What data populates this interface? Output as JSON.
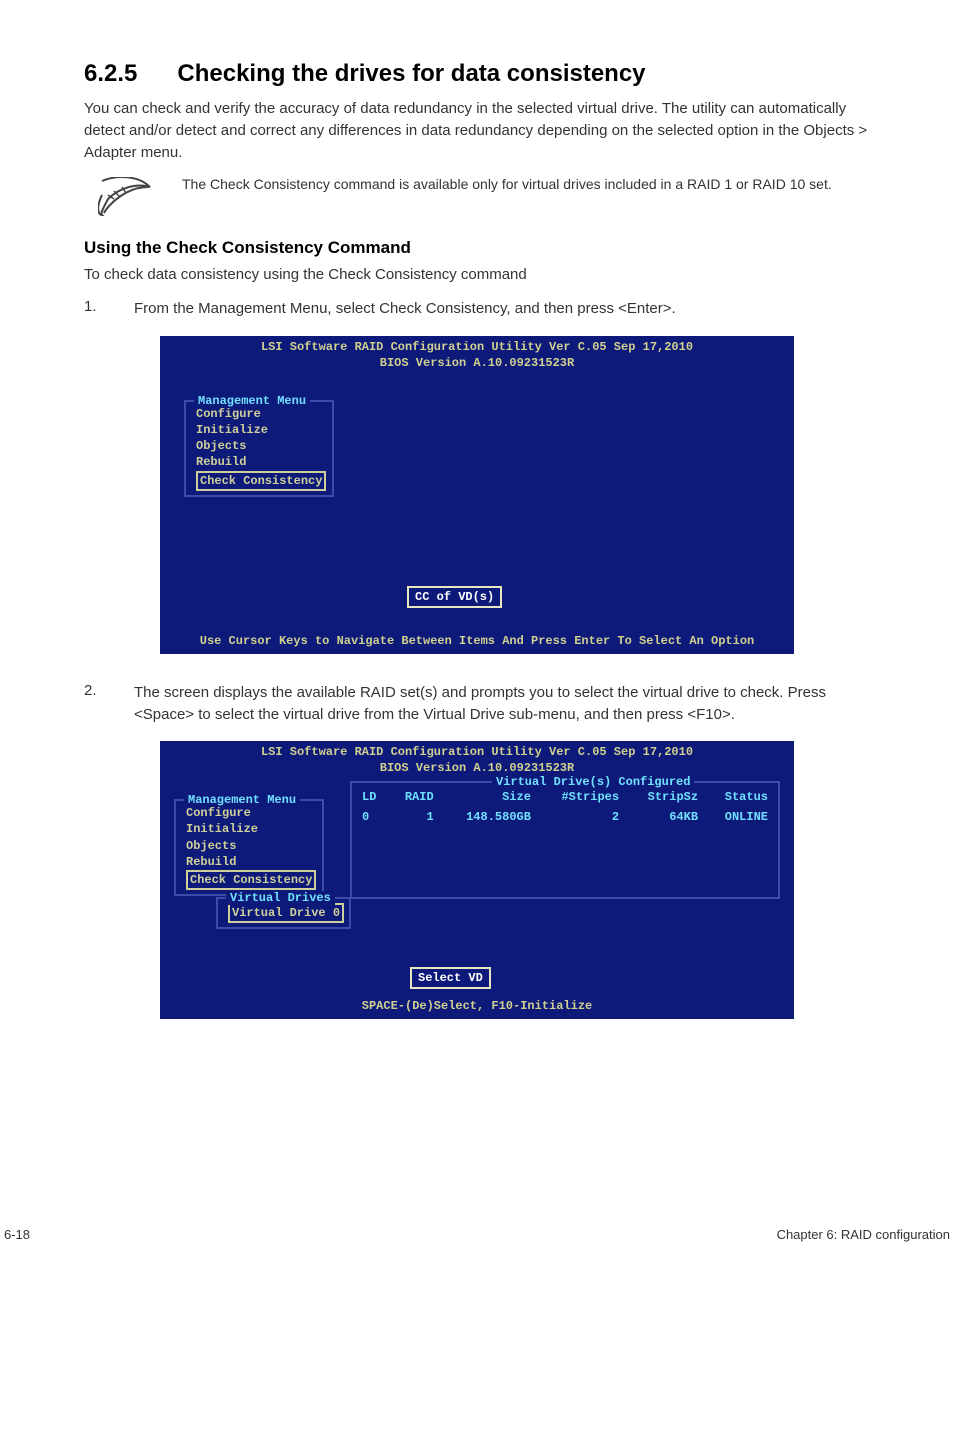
{
  "section": {
    "number": "6.2.5",
    "title": "Checking the drives for data consistency"
  },
  "intro": "You can check and verify the accuracy of data redundancy in the selected virtual drive. The utility can automatically detect and/or detect and correct any differences in data redundancy depending on the selected option in the Objects > Adapter menu.",
  "note": "The Check Consistency command is available only for virtual drives included in a RAID 1 or RAID 10 set.",
  "subhead": "Using the Check Consistency Command",
  "sublead": "To check data consistency using the Check Consistency command",
  "steps": {
    "s1": {
      "num": "1.",
      "text": "From the Management Menu, select Check Consistency, and then press <Enter>."
    },
    "s2": {
      "num": "2.",
      "text": "The screen displays the available RAID set(s) and prompts you to select the virtual drive to check. Press <Space> to select the virtual drive from the Virtual Drive sub-menu, and then press <F10>."
    }
  },
  "bios": {
    "title": "LSI Software RAID Configuration Utility Ver C.05 Sep 17,2010",
    "subtitle": "BIOS Version  A.10.09231523R",
    "mgmt_label": "Management Menu",
    "items": {
      "configure": "Configure",
      "initialize": "Initialize",
      "objects": "Objects",
      "rebuild": "Rebuild",
      "check": "Check Consistency"
    },
    "cc_label": "CC of VD(s)",
    "footer1": "Use Cursor Keys to Navigate Between Items And Press Enter To Select An Option",
    "vd_configured": "Virtual Drive(s) Configured",
    "cols": {
      "ld": "LD",
      "raid": "RAID",
      "size": "Size",
      "stripes": "#Stripes",
      "stripsz": "StripSz",
      "status": "Status"
    },
    "row0": {
      "ld": "0",
      "raid": "1",
      "size": "148.580GB",
      "stripes": "2",
      "stripsz": "64KB",
      "status": "ONLINE"
    },
    "vd_box_label": "Virtual Drives",
    "vd0": "Virtual Drive 0",
    "select_vd": "Select VD",
    "footer2": "SPACE-(De)Select, F10-Initialize"
  },
  "footer": {
    "left": "6-18",
    "right": "Chapter 6: RAID configuration"
  }
}
